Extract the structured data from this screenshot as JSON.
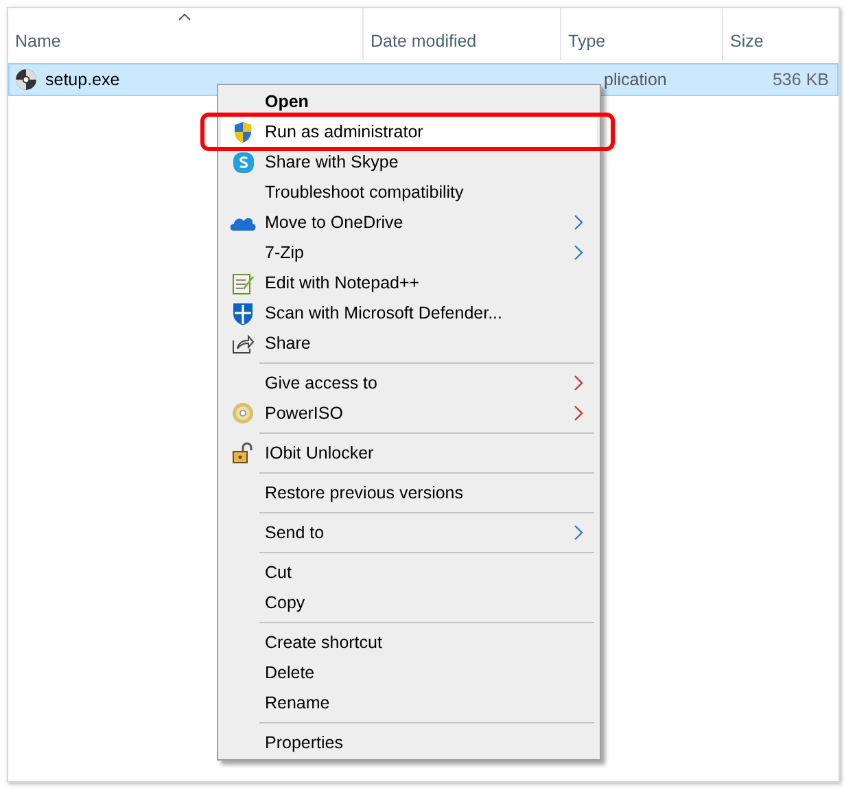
{
  "columns": [
    {
      "label": "Name",
      "sorted": true
    },
    {
      "label": "Date modified",
      "sorted": false
    },
    {
      "label": "Type",
      "sorted": false
    },
    {
      "label": "Size",
      "sorted": false
    }
  ],
  "files": [
    {
      "name": "setup.exe",
      "type": "plication",
      "size": "536 KB",
      "selected": true
    }
  ],
  "context_menu": [
    {
      "kind": "item",
      "label": "Open",
      "default": true,
      "submenu": false,
      "highlighted": false
    },
    {
      "kind": "item",
      "label": "Run as administrator",
      "default": false,
      "submenu": false,
      "highlighted": true
    },
    {
      "kind": "item",
      "label": "Share with Skype",
      "default": false,
      "submenu": false,
      "highlighted": false
    },
    {
      "kind": "item",
      "label": "Troubleshoot compatibility",
      "default": false,
      "submenu": false,
      "highlighted": false
    },
    {
      "kind": "item",
      "label": "Move to OneDrive",
      "default": false,
      "submenu": true,
      "highlighted": false
    },
    {
      "kind": "item",
      "label": "7-Zip",
      "default": false,
      "submenu": true,
      "highlighted": false
    },
    {
      "kind": "item",
      "label": "Edit with Notepad++",
      "default": false,
      "submenu": false,
      "highlighted": false
    },
    {
      "kind": "item",
      "label": "Scan with Microsoft Defender...",
      "default": false,
      "submenu": false,
      "highlighted": false
    },
    {
      "kind": "item",
      "label": "Share",
      "default": false,
      "submenu": false,
      "highlighted": false
    },
    {
      "kind": "separator"
    },
    {
      "kind": "item",
      "label": "Give access to",
      "default": false,
      "submenu": true,
      "highlighted": false
    },
    {
      "kind": "item",
      "label": "PowerISO",
      "default": false,
      "submenu": true,
      "highlighted": false
    },
    {
      "kind": "separator"
    },
    {
      "kind": "item",
      "label": "IObit Unlocker",
      "default": false,
      "submenu": false,
      "highlighted": false
    },
    {
      "kind": "separator"
    },
    {
      "kind": "item",
      "label": "Restore previous versions",
      "default": false,
      "submenu": false,
      "highlighted": false
    },
    {
      "kind": "separator"
    },
    {
      "kind": "item",
      "label": "Send to",
      "default": false,
      "submenu": true,
      "highlighted": false
    },
    {
      "kind": "separator"
    },
    {
      "kind": "item",
      "label": "Cut",
      "default": false,
      "submenu": false,
      "highlighted": false
    },
    {
      "kind": "item",
      "label": "Copy",
      "default": false,
      "submenu": false,
      "highlighted": false
    },
    {
      "kind": "separator"
    },
    {
      "kind": "item",
      "label": "Create shortcut",
      "default": false,
      "submenu": false,
      "highlighted": false
    },
    {
      "kind": "item",
      "label": "Delete",
      "default": false,
      "submenu": false,
      "highlighted": false
    },
    {
      "kind": "item",
      "label": "Rename",
      "default": false,
      "submenu": false,
      "highlighted": false
    },
    {
      "kind": "separator"
    },
    {
      "kind": "item",
      "label": "Properties",
      "default": false,
      "submenu": false,
      "highlighted": false
    }
  ]
}
